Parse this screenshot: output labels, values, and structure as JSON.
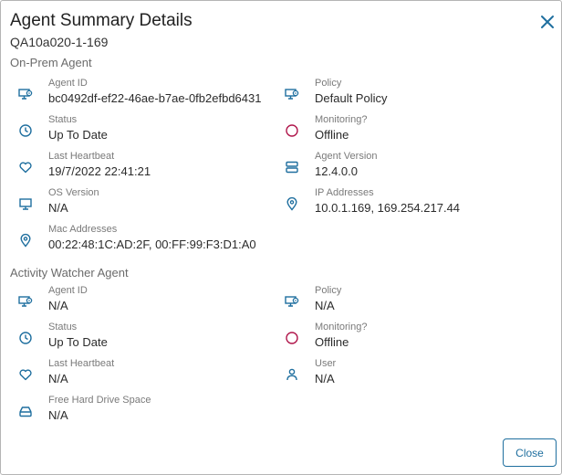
{
  "dialog": {
    "title": "Agent Summary Details",
    "subtitle": "QA10a020-1-169",
    "close_label": "Close"
  },
  "onprem": {
    "heading": "On-Prem Agent",
    "agent_id": {
      "label": "Agent ID",
      "value": "bc0492df-ef22-46ae-b7ae-0fb2efbd6431"
    },
    "policy": {
      "label": "Policy",
      "value": "Default Policy"
    },
    "status": {
      "label": "Status",
      "value": "Up To Date"
    },
    "monitoring": {
      "label": "Monitoring?",
      "value": "Offline"
    },
    "last_heartbeat": {
      "label": "Last Heartbeat",
      "value": "19/7/2022 22:41:21"
    },
    "agent_version": {
      "label": "Agent Version",
      "value": "12.4.0.0"
    },
    "os_version": {
      "label": "OS Version",
      "value": "N/A"
    },
    "ip_addresses": {
      "label": "IP Addresses",
      "value": "10.0.1.169, 169.254.217.44"
    },
    "mac_addresses": {
      "label": "Mac Addresses",
      "value": "00:22:48:1C:AD:2F, 00:FF:99:F3:D1:A0"
    }
  },
  "watcher": {
    "heading": "Activity Watcher Agent",
    "agent_id": {
      "label": "Agent ID",
      "value": "N/A"
    },
    "policy": {
      "label": "Policy",
      "value": "N/A"
    },
    "status": {
      "label": "Status",
      "value": "Up To Date"
    },
    "monitoring": {
      "label": "Monitoring?",
      "value": "Offline"
    },
    "last_heartbeat": {
      "label": "Last Heartbeat",
      "value": "N/A"
    },
    "user": {
      "label": "User",
      "value": "N/A"
    },
    "free_space": {
      "label": "Free Hard Drive Space",
      "value": "N/A"
    }
  },
  "colors": {
    "accent": "#1f6f9f",
    "offline": "#b0164b",
    "icon": "#1f6f9f"
  },
  "icons": {
    "agent_id": "monitor-gear-icon",
    "policy": "monitor-gear-icon",
    "status": "clock-icon",
    "monitoring": "circle-icon",
    "last_heartbeat": "heart-icon",
    "agent_version": "server-icon",
    "os_version": "monitor-icon",
    "ip_addresses": "location-pin-icon",
    "mac_addresses": "location-pin-icon",
    "user": "user-icon",
    "free_space": "hard-drive-icon"
  }
}
